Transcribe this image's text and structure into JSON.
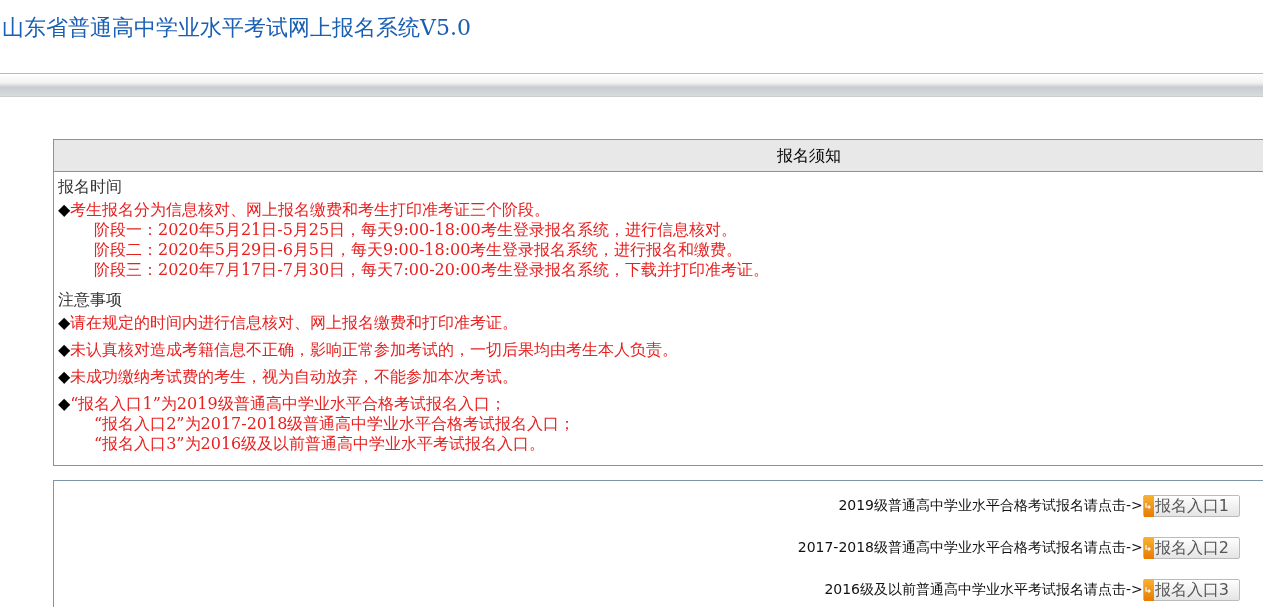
{
  "title": "山东省普通高中学业水平考试网上报名系统V5.0",
  "notice": {
    "heading": "报名须知",
    "sections": [
      {
        "heading": "报名时间",
        "items": [
          {
            "bullet": "◆",
            "lines": [
              "考生报名分为信息核对、网上报名缴费和考生打印准考证三个阶段。",
              "阶段一：2020年5月21日-5月25日，每天9:00-18:00考生登录报名系统，进行信息核对。",
              "阶段二：2020年5月29日-6月5日，每天9:00-18:00考生登录报名系统，进行报名和缴费。",
              "阶段三：2020年7月17日-7月30日，每天7:00-20:00考生登录报名系统，下载并打印准考证。"
            ]
          }
        ]
      },
      {
        "heading": "注意事项",
        "items": [
          {
            "bullet": "◆",
            "lines": [
              "请在规定的时间内进行信息核对、网上报名缴费和打印准考证。"
            ]
          },
          {
            "bullet": "◆",
            "lines": [
              "未认真核对造成考籍信息不正确，影响正常参加考试的，一切后果均由考生本人负责。"
            ]
          },
          {
            "bullet": "◆",
            "lines": [
              "未成功缴纳考试费的考生，视为自动放弃，不能参加本次考试。"
            ]
          },
          {
            "bullet": "◆",
            "lines": [
              "“报名入口1”为2019级普通高中学业水平合格考试报名入口；",
              "“报名入口2”为2017-2018级普通高中学业水平合格考试报名入口；",
              "“报名入口3”为2016级及以前普通高中学业水平考试报名入口。"
            ]
          }
        ]
      }
    ]
  },
  "entries": [
    {
      "label": "2019级普通高中学业水平合格考试报名请点击->",
      "button": "报名入口1"
    },
    {
      "label": "2017-2018级普通高中学业水平合格考试报名请点击->",
      "button": "报名入口2"
    },
    {
      "label": "2016级及以前普通高中学业水平考试报名请点击->",
      "button": "报名入口3"
    }
  ]
}
